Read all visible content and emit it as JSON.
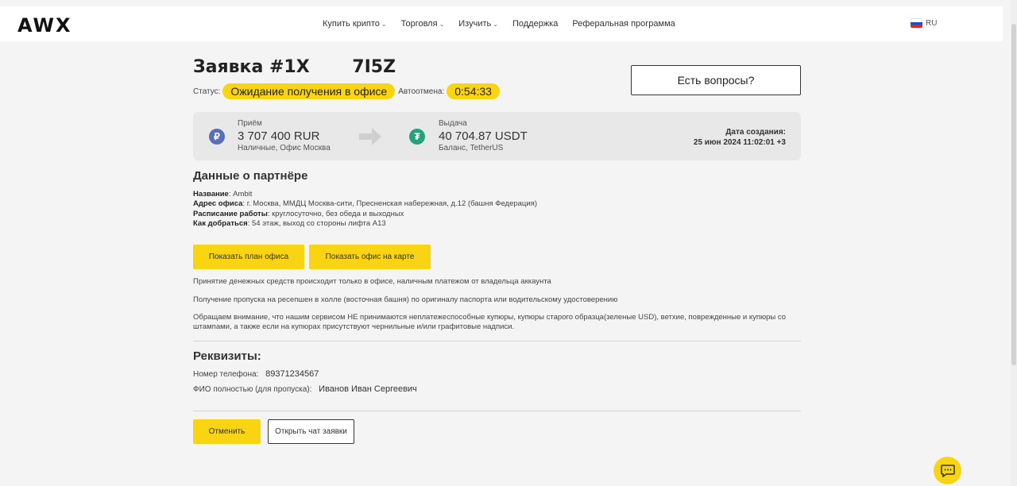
{
  "header": {
    "logo": "AWX",
    "nav": [
      {
        "label": "Купить крипто",
        "has_dropdown": true
      },
      {
        "label": "Торговля",
        "has_dropdown": true
      },
      {
        "label": "Изучить",
        "has_dropdown": true
      },
      {
        "label": "Поддержка",
        "has_dropdown": false
      },
      {
        "label": "Реферальная программа",
        "has_dropdown": false
      }
    ],
    "dropdown_chevron": "⌄",
    "language": "RU",
    "flag_colors": [
      "#ffffff",
      "#1f4fbf",
      "#d52b1e"
    ]
  },
  "order": {
    "title": "Заявка #1X       7I5Z",
    "status_label": "Статус:",
    "status_value": "Ожидание получения в офисе",
    "autocancel_label": "Автоотмена:",
    "autocancel_timer": "0:54:33",
    "questions_button": "Есть вопросы?"
  },
  "exchange": {
    "in": {
      "label": "Приём",
      "amount": "3 707 400 RUR",
      "method": "Наличные, Офис Москва",
      "icon": "rub-coin-icon",
      "symbol": "₽"
    },
    "out": {
      "label": "Выдача",
      "amount": "40 704.87 USDT",
      "method": "Баланс, TetherUS",
      "icon": "tether-coin-icon",
      "symbol": "₮"
    },
    "created_label": "Дата создания:",
    "created_value": "25 июн 2024 11:02:01 +3"
  },
  "partner": {
    "heading": "Данные о партнёре",
    "fields": [
      {
        "label": "Название",
        "value": ": Ambit"
      },
      {
        "label": "Адрес офиса",
        "value": ": г. Москва, ММДЦ Москва-сити, Пресненская набережная, д.12 (башня Федерация)"
      },
      {
        "label": "Расписание работы",
        "value": ": круглосуточно, без обеда и выходных"
      },
      {
        "label": "Как добраться",
        "value": ": 54 этаж, выход со стороны лифта А13"
      }
    ],
    "show_plan_button": "Показать план офиса",
    "show_map_button": "Показать офис на карте"
  },
  "notes": [
    "Принятие денежных средств происходит только в офисе, наличным платежом от владельца аккаунта",
    "Получение пропуска на ресепшен в холле (восточная башня) по оригиналу паспорта или водительскому удостоверению",
    "Обращаем внимание, что нашим сервисом НЕ принимаются неплатежеспособные купюры, купюры старого образца(зеленые USD), ветхие, поврежденные и купюры со штампами, а также если на купюрах присутствуют чернильные и/или графитовые надписи."
  ],
  "requisites": {
    "heading": "Реквизиты:",
    "phone_label": "Номер телефона:",
    "phone_value": "89371234567",
    "name_label": "ФИО полностью (для пропуска):",
    "name_value": "Иванов Иван Сергеевич"
  },
  "actions": {
    "cancel_button": "Отменить",
    "open_chat_button": "Открыть чат заявки"
  },
  "colors": {
    "accent": "#f9d413",
    "background": "#f4f4f4",
    "panel": "#e8e8e8"
  }
}
